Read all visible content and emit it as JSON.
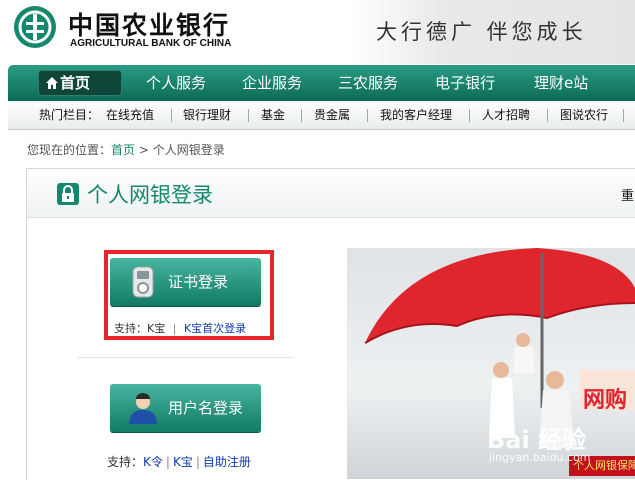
{
  "header": {
    "bank_name_cn": "中国农业银行",
    "bank_name_en": "AGRICULTURAL BANK OF CHINA",
    "slogan": "大行德广  伴您成长"
  },
  "nav": {
    "items": [
      {
        "label": "首页"
      },
      {
        "label": "个人服务"
      },
      {
        "label": "企业服务"
      },
      {
        "label": "三农服务"
      },
      {
        "label": "电子银行"
      },
      {
        "label": "理财e站"
      }
    ]
  },
  "subnav": {
    "prefix": "热门栏目：",
    "items": [
      {
        "label": "在线充值"
      },
      {
        "label": "银行理财"
      },
      {
        "label": "基金"
      },
      {
        "label": "贵金属"
      },
      {
        "label": "我的客户经理"
      },
      {
        "label": "人才招聘"
      },
      {
        "label": "图说农行"
      }
    ]
  },
  "breadcrumb": {
    "prefix": "您现在的位置：",
    "home": "首页",
    "arrow": ">",
    "current": "个人网银登录"
  },
  "panel": {
    "title": "个人网银登录",
    "right_text": "重"
  },
  "cert_login": {
    "label": "证书登录",
    "support_prefix": "支持：K宝",
    "sep": "|",
    "link": "K宝首次登录"
  },
  "username_login": {
    "label": "用户名登录",
    "support_prefix": "支持：",
    "links": [
      "K令",
      "K宝",
      "自助注册"
    ],
    "sep": "|"
  },
  "banner": {
    "text_big": "网购",
    "text_small": "个人网银保障",
    "watermark": "Bai 经验",
    "watermark_url": "jingyan.baidu.com"
  },
  "colors": {
    "brand_green": "#14876c",
    "nav_green": "#1f8a72",
    "highlight_red": "#e8252b",
    "link_blue": "#0f3aa7"
  }
}
